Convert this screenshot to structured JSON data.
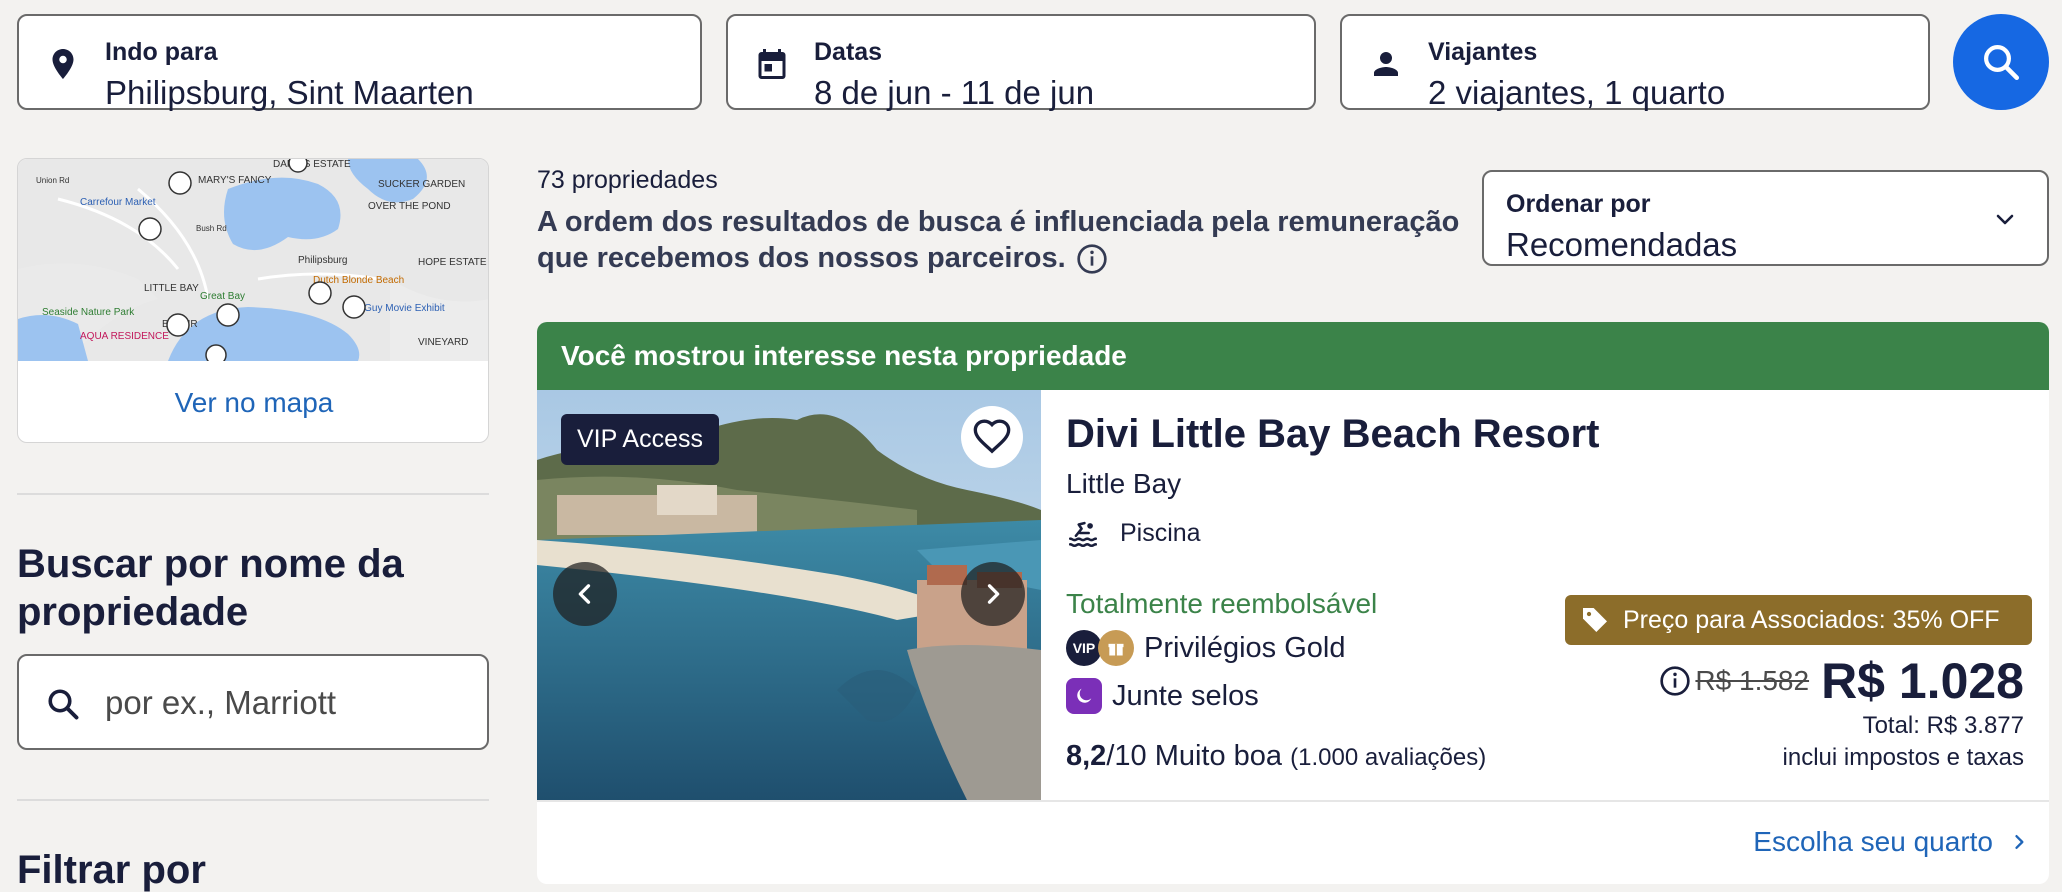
{
  "search": {
    "destination": {
      "label": "Indo para",
      "value": "Philipsburg, Sint Maarten",
      "icon": "location-pin-icon"
    },
    "dates": {
      "label": "Datas",
      "value": "8 de jun - 11 de jun",
      "icon": "calendar-icon"
    },
    "travelers": {
      "label": "Viajantes",
      "value": "2 viajantes, 1 quarto",
      "icon": "person-icon"
    },
    "button_icon": "search-icon"
  },
  "sidebar": {
    "map_link": "Ver no mapa",
    "map_labels": [
      "DAME'S ESTATE",
      "MARY'S FANCY",
      "SUCKER GARDEN",
      "OVER THE POND",
      "Carrefour Market",
      "Philipsburg",
      "HOPE ESTATE",
      "Dutch Blonde Beach",
      "Great Bay",
      "LITTLE BAY",
      "BELAIR",
      "Seaside Nature Park",
      "Lisa Guy Movie Exhibit",
      "AQUA RESIDENCE",
      "VINEYARD",
      "Bush Rd",
      "Union Rd"
    ],
    "name_search": {
      "title": "Buscar por nome da propriedade",
      "placeholder": "por ex., Marriott"
    },
    "filter_title": "Filtrar por"
  },
  "results": {
    "count": "73 propriedades",
    "disclaimer": "A ordem dos resultados de busca é influenciada pela remuneração que recebemos dos nossos parceiros.",
    "sort": {
      "label": "Ordenar por",
      "value": "Recomendadas"
    }
  },
  "listing": {
    "banner": "Você mostrou interesse nesta propriedade",
    "vip_badge": "VIP Access",
    "name": "Divi Little Bay Beach Resort",
    "area": "Little Bay",
    "amenity": "Piscina",
    "refund": "Totalmente reembolsável",
    "vip_chip": "VIP",
    "privileges": "Privilégios Gold",
    "stamps": "Junte selos",
    "rating_score": "8,2",
    "rating_text": "/10 Muito boa",
    "rating_count": "(1.000 avaliações)",
    "member_badge": "Preço para Associados: 35% OFF",
    "old_price": "R$ 1.582",
    "price": "R$ 1.028",
    "total": "Total: R$ 3.877",
    "taxes": "inclui impostos e taxas",
    "cta": "Escolha seu quarto"
  },
  "colors": {
    "accent": "#1668e3",
    "link": "#1f65b8",
    "banner_green": "#3b8349",
    "member_gold": "#8c6d2a",
    "stamps_purple": "#7b2fb8",
    "background": "#f3f2f0"
  }
}
